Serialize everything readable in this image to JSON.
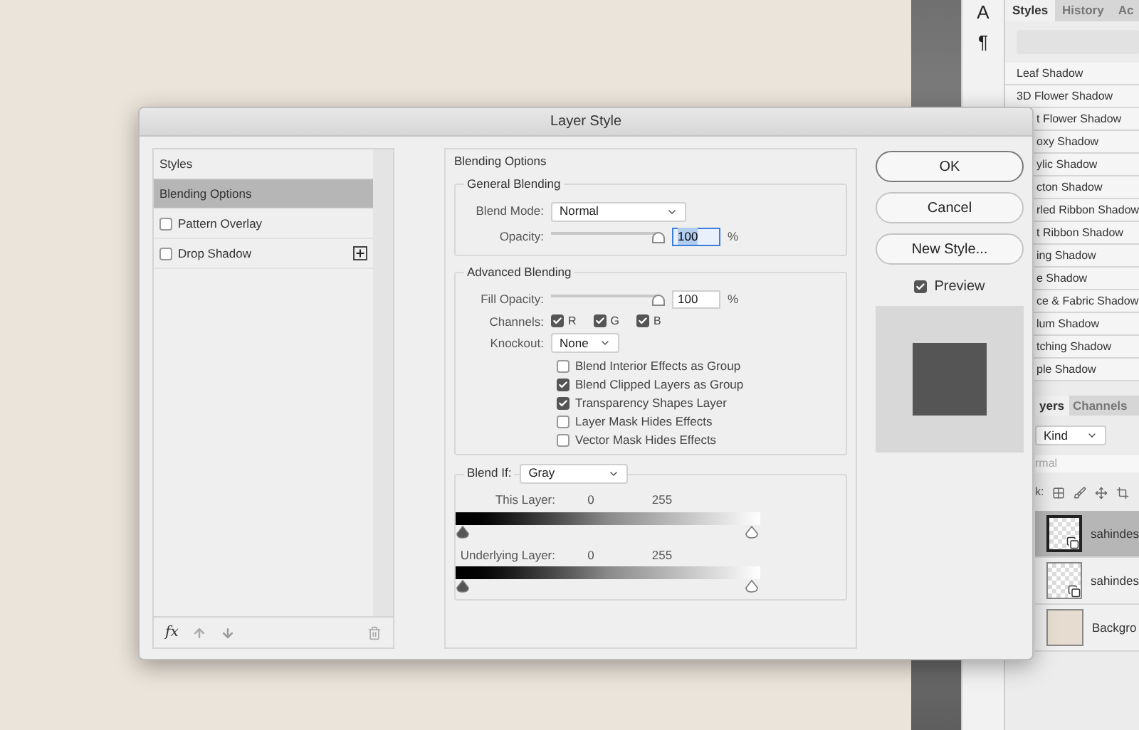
{
  "tool_strip": {
    "glyphs": [
      "A",
      "¶"
    ]
  },
  "styles_panel": {
    "tabs": [
      {
        "label": "Styles",
        "selected": true
      },
      {
        "label": "History",
        "selected": false
      },
      {
        "label": "Ac",
        "selected": false
      }
    ],
    "items": [
      "Leaf Shadow",
      "3D Flower Shadow",
      "t Flower Shadow",
      "oxy Shadow",
      "ylic Shadow",
      "cton Shadow",
      "rled Ribbon Shadow",
      "t Ribbon Shadow",
      "ing Shadow",
      "e Shadow",
      "ce & Fabric Shadow",
      "lum Shadow",
      "tching Shadow",
      "ple Shadow"
    ]
  },
  "layers_panel": {
    "tabs": [
      {
        "label": "yers",
        "selected": true
      },
      {
        "label": "Channels",
        "selected": false
      }
    ],
    "filter": "Kind",
    "blend_mode": "rmal",
    "lock_label": "k:",
    "layers": [
      {
        "name": "sahindes",
        "selected": true,
        "kind": "smart"
      },
      {
        "name": "sahindes",
        "selected": false,
        "kind": "smart"
      },
      {
        "name": "Backgro",
        "selected": false,
        "kind": "background"
      }
    ]
  },
  "dialog": {
    "title": "Layer Style",
    "style_list": {
      "header": "Styles",
      "items": [
        {
          "label": "Blending Options",
          "selected": true,
          "kind": "plain"
        },
        {
          "label": "Pattern Overlay",
          "selected": false,
          "kind": "check",
          "checked": false
        },
        {
          "label": "Drop Shadow",
          "selected": false,
          "kind": "check_plus",
          "checked": false
        }
      ],
      "fx": "fx"
    },
    "blending": {
      "title": "Blending Options",
      "general": {
        "title": "General Blending",
        "blend_mode_label": "Blend Mode:",
        "blend_mode": "Normal",
        "opacity_label": "Opacity:",
        "opacity": {
          "level": 1,
          "value": "100",
          "text_selected": true
        },
        "percent": "%"
      },
      "advanced": {
        "title": "Advanced Blending",
        "fill_label": "Fill Opacity:",
        "fill": {
          "level": 1,
          "value": "100",
          "text_selected": false
        },
        "percent": "%",
        "channels_label": "Channels:",
        "channels": [
          {
            "label": "R",
            "checked": true
          },
          {
            "label": "G",
            "checked": true
          },
          {
            "label": "B",
            "checked": true
          }
        ],
        "knockout_label": "Knockout:",
        "knockout": "None",
        "options": [
          {
            "label": "Blend Interior Effects as Group",
            "checked": false
          },
          {
            "label": "Blend Clipped Layers as Group",
            "checked": true
          },
          {
            "label": "Transparency Shapes Layer",
            "checked": true
          },
          {
            "label": "Layer Mask Hides Effects",
            "checked": false
          },
          {
            "label": "Vector Mask Hides Effects",
            "checked": false
          }
        ]
      },
      "blend_if": {
        "label": "Blend If:",
        "value": "Gray",
        "sliders": [
          {
            "label": "This Layer:",
            "low": "0",
            "high": "255"
          },
          {
            "label": "Underlying Layer:",
            "low": "0",
            "high": "255"
          }
        ]
      }
    },
    "buttons": [
      {
        "label": "OK",
        "default": true
      },
      {
        "label": "Cancel",
        "default": false
      },
      {
        "label": "New Style...",
        "default": false
      }
    ],
    "preview": {
      "label": "Preview",
      "checked": true
    }
  }
}
